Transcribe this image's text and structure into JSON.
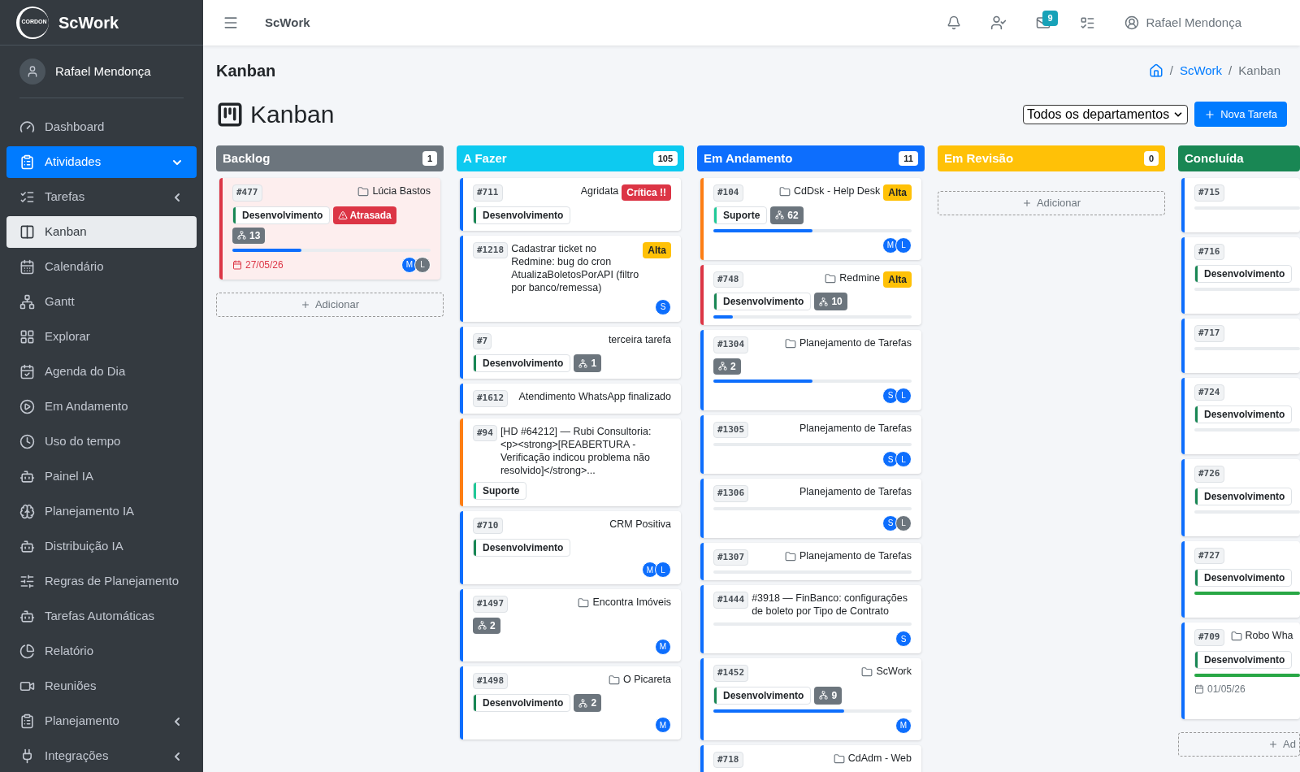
{
  "brand": {
    "logo_text": "CORDON",
    "name": "ScWork"
  },
  "sidebar": {
    "user": "Rafael Mendonça",
    "items": [
      {
        "label": "Dashboard",
        "kind": "link",
        "selected": false
      },
      {
        "label": "Atividades",
        "kind": "group",
        "expanded": true,
        "selected": false
      },
      {
        "label": "Tarefas",
        "kind": "group",
        "expanded": false,
        "selected": false
      },
      {
        "label": "Kanban",
        "kind": "link",
        "selected": true
      },
      {
        "label": "Calendário",
        "kind": "link",
        "selected": false
      },
      {
        "label": "Gantt",
        "kind": "link",
        "selected": false
      },
      {
        "label": "Explorar",
        "kind": "link",
        "selected": false
      },
      {
        "label": "Agenda do Dia",
        "kind": "link",
        "selected": false
      },
      {
        "label": "Em Andamento",
        "kind": "link",
        "selected": false
      },
      {
        "label": "Uso do tempo",
        "kind": "link",
        "selected": false
      },
      {
        "label": "Painel IA",
        "kind": "link",
        "selected": false
      },
      {
        "label": "Planejamento IA",
        "kind": "link",
        "selected": false
      },
      {
        "label": "Distribuição IA",
        "kind": "link",
        "selected": false
      },
      {
        "label": "Regras de Planejamento",
        "kind": "link",
        "selected": false
      },
      {
        "label": "Tarefas Automáticas",
        "kind": "link",
        "selected": false
      },
      {
        "label": "Relatório",
        "kind": "link",
        "selected": false
      },
      {
        "label": "Reuniões",
        "kind": "link",
        "selected": false
      },
      {
        "label": "Planejamento",
        "kind": "group",
        "expanded": false,
        "selected": false
      },
      {
        "label": "Integrações",
        "kind": "group",
        "expanded": false,
        "selected": false
      }
    ]
  },
  "topbar": {
    "title": "ScWork",
    "messages_count": "9",
    "user": "Rafael Mendonça"
  },
  "page": {
    "heading": "Kanban",
    "breadcrumb": [
      "ScWork",
      "Kanban"
    ],
    "breadcrumb_separator": "/",
    "title": "Kanban",
    "department_filter": "Todos os departamentos",
    "new_button": "Nova Tarefa"
  },
  "columns": [
    {
      "title": "Backlog",
      "count": "1",
      "color": "#6c757d",
      "add_label": "Adicionar",
      "cards": [
        {
          "id": "#477",
          "title": "Lúcia Bastos",
          "folder": true,
          "color": "#dc3545",
          "overdue": true,
          "tags": [
            {
              "kind": "dept",
              "label": "Desenvolvimento",
              "color": "#198754"
            },
            {
              "kind": "late",
              "label": "Atrasada"
            },
            {
              "kind": "sub",
              "label": "13"
            }
          ],
          "level": 0.35,
          "date": "27/05/26",
          "avatars": [
            {
              "letter": "M",
              "color": "#0d6efd"
            },
            {
              "letter": "L",
              "color": "#6c757d"
            }
          ]
        }
      ]
    },
    {
      "title": "A Fazer",
      "count": "105",
      "color": "#0dcaf0",
      "cards": [
        {
          "id": "#711",
          "title": "Agridata",
          "color": "#0d6efd",
          "priority": {
            "kind": "critical",
            "label": "Crítica !!"
          },
          "tags": [
            {
              "kind": "dept",
              "label": "Desenvolvimento",
              "color": "#198754"
            }
          ]
        },
        {
          "id": "#1218",
          "title": "Cadastrar ticket no Redmine: bug do cron AtualizaBoletosPorAPI (filtro por banco/remessa)",
          "color": "#0d6efd",
          "priority": {
            "kind": "high",
            "label": "Alta"
          },
          "avatars": [
            {
              "letter": "S",
              "color": "#0d6efd"
            }
          ]
        },
        {
          "id": "#7",
          "title": "terceira tarefa",
          "color": "#0d6efd",
          "tags": [
            {
              "kind": "dept",
              "label": "Desenvolvimento",
              "color": "#198754"
            },
            {
              "kind": "sub",
              "label": "1"
            }
          ]
        },
        {
          "id": "#1612",
          "title": "Atendimento WhatsApp finalizado",
          "color": "#0d6efd"
        },
        {
          "id": "#94",
          "title": "[HD #64212] — Rubi Consultoria: <p><strong>[REABERTURA - Verificação indicou problema não resolvido]</strong>...",
          "color": "#fd7e14",
          "tags": [
            {
              "kind": "dept",
              "label": "Suporte",
              "color": "#20c997"
            }
          ]
        },
        {
          "id": "#710",
          "title": "CRM Positiva",
          "color": "#0d6efd",
          "tags": [
            {
              "kind": "dept",
              "label": "Desenvolvimento",
              "color": "#198754"
            }
          ],
          "avatars": [
            {
              "letter": "M",
              "color": "#0d6efd"
            },
            {
              "letter": "L",
              "color": "#0d6efd"
            }
          ]
        },
        {
          "id": "#1497",
          "title": "Encontra Imóveis",
          "folder": true,
          "color": "#0d6efd",
          "tags": [
            {
              "kind": "sub",
              "label": "2"
            }
          ],
          "avatars": [
            {
              "letter": "M",
              "color": "#0d6efd"
            }
          ]
        },
        {
          "id": "#1498",
          "title": "O Picareta",
          "folder": true,
          "color": "#0d6efd",
          "tags": [
            {
              "kind": "dept",
              "label": "Desenvolvimento",
              "color": "#198754"
            },
            {
              "kind": "sub",
              "label": "2"
            }
          ],
          "avatars": [
            {
              "letter": "M",
              "color": "#0d6efd"
            }
          ]
        }
      ]
    },
    {
      "title": "Em Andamento",
      "count": "11",
      "color": "#0d6efd",
      "cards": [
        {
          "id": "#104",
          "title": "CdDsk - Help Desk",
          "folder": true,
          "color": "#fd7e14",
          "priority": {
            "kind": "high",
            "label": "Alta"
          },
          "tags": [
            {
              "kind": "dept",
              "label": "Suporte",
              "color": "#20c997"
            },
            {
              "kind": "sub",
              "label": "62"
            }
          ],
          "level": 0.5,
          "avatars": [
            {
              "letter": "M",
              "color": "#0d6efd"
            },
            {
              "letter": "L",
              "color": "#0d6efd"
            }
          ]
        },
        {
          "id": "#748",
          "title": "Redmine",
          "folder": true,
          "color": "#dc3545",
          "priority": {
            "kind": "high",
            "label": "Alta"
          },
          "tags": [
            {
              "kind": "dept",
              "label": "Desenvolvimento",
              "color": "#198754"
            },
            {
              "kind": "sub",
              "label": "10"
            }
          ],
          "level": 0.1
        },
        {
          "id": "#1304",
          "title": "Planejamento de Tarefas",
          "folder": true,
          "color": "#0d6efd",
          "tags": [
            {
              "kind": "sub",
              "label": "2"
            }
          ],
          "level": 0.5,
          "avatars": [
            {
              "letter": "S",
              "color": "#0d6efd"
            },
            {
              "letter": "L",
              "color": "#0d6efd"
            }
          ]
        },
        {
          "id": "#1305",
          "title": "Planejamento de Tarefas",
          "color": "#0d6efd",
          "level": 0,
          "avatars": [
            {
              "letter": "S",
              "color": "#0d6efd"
            },
            {
              "letter": "L",
              "color": "#0d6efd"
            }
          ]
        },
        {
          "id": "#1306",
          "title": "Planejamento de Tarefas",
          "color": "#0d6efd",
          "level": 0,
          "avatars": [
            {
              "letter": "S",
              "color": "#0d6efd"
            },
            {
              "letter": "L",
              "color": "#6c757d"
            }
          ]
        },
        {
          "id": "#1307",
          "title": "Planejamento de Tarefas",
          "folder": true,
          "color": "#0d6efd",
          "level": 0
        },
        {
          "id": "#1444",
          "title": "#3918 — FinBanco: configurações de boleto por Tipo de Contrato",
          "color": "#0d6efd",
          "level": 0,
          "avatars": [
            {
              "letter": "S",
              "color": "#0d6efd"
            }
          ]
        },
        {
          "id": "#1452",
          "title": "ScWork",
          "folder": true,
          "color": "#0d6efd",
          "tags": [
            {
              "kind": "dept",
              "label": "Desenvolvimento",
              "color": "#198754"
            },
            {
              "kind": "sub",
              "label": "9"
            }
          ],
          "level": 0.66,
          "avatars": [
            {
              "letter": "M",
              "color": "#0d6efd"
            }
          ]
        },
        {
          "id": "#718",
          "title": "CdAdm - Web",
          "folder": true,
          "color": "#0d6efd"
        }
      ]
    },
    {
      "title": "Em Revisão",
      "count": "0",
      "color": "#ffc107",
      "add_label": "Adicionar"
    },
    {
      "title": "Concluída",
      "color": "#198754",
      "clipped": true,
      "add_label": "Ad",
      "cards": [
        {
          "id": "#715",
          "color": "#0d6efd",
          "level": 0
        },
        {
          "id": "#716",
          "color": "#0d6efd",
          "tags": [
            {
              "kind": "dept",
              "label": "Desenvolvimento",
              "color": "#198754"
            }
          ],
          "level": 0
        },
        {
          "id": "#717",
          "color": "#0d6efd",
          "level": 0
        },
        {
          "id": "#724",
          "color": "#0d6efd",
          "tags": [
            {
              "kind": "dept",
              "label": "Desenvolvimento",
              "color": "#198754"
            }
          ],
          "level": 0
        },
        {
          "id": "#726",
          "color": "#0d6efd",
          "tags": [
            {
              "kind": "dept",
              "label": "Desenvolvimento",
              "color": "#198754"
            }
          ],
          "level": 0
        },
        {
          "id": "#727",
          "color": "#0d6efd",
          "tags": [
            {
              "kind": "dept",
              "label": "Desenvolvimento",
              "color": "#198754"
            }
          ],
          "level": 1
        },
        {
          "id": "#709",
          "title": "Robo Wha",
          "folder": true,
          "color": "#0d6efd",
          "tags": [
            {
              "kind": "dept",
              "label": "Desenvolvimento",
              "color": "#198754"
            }
          ],
          "level": 1,
          "date": "01/05/26"
        }
      ]
    }
  ]
}
